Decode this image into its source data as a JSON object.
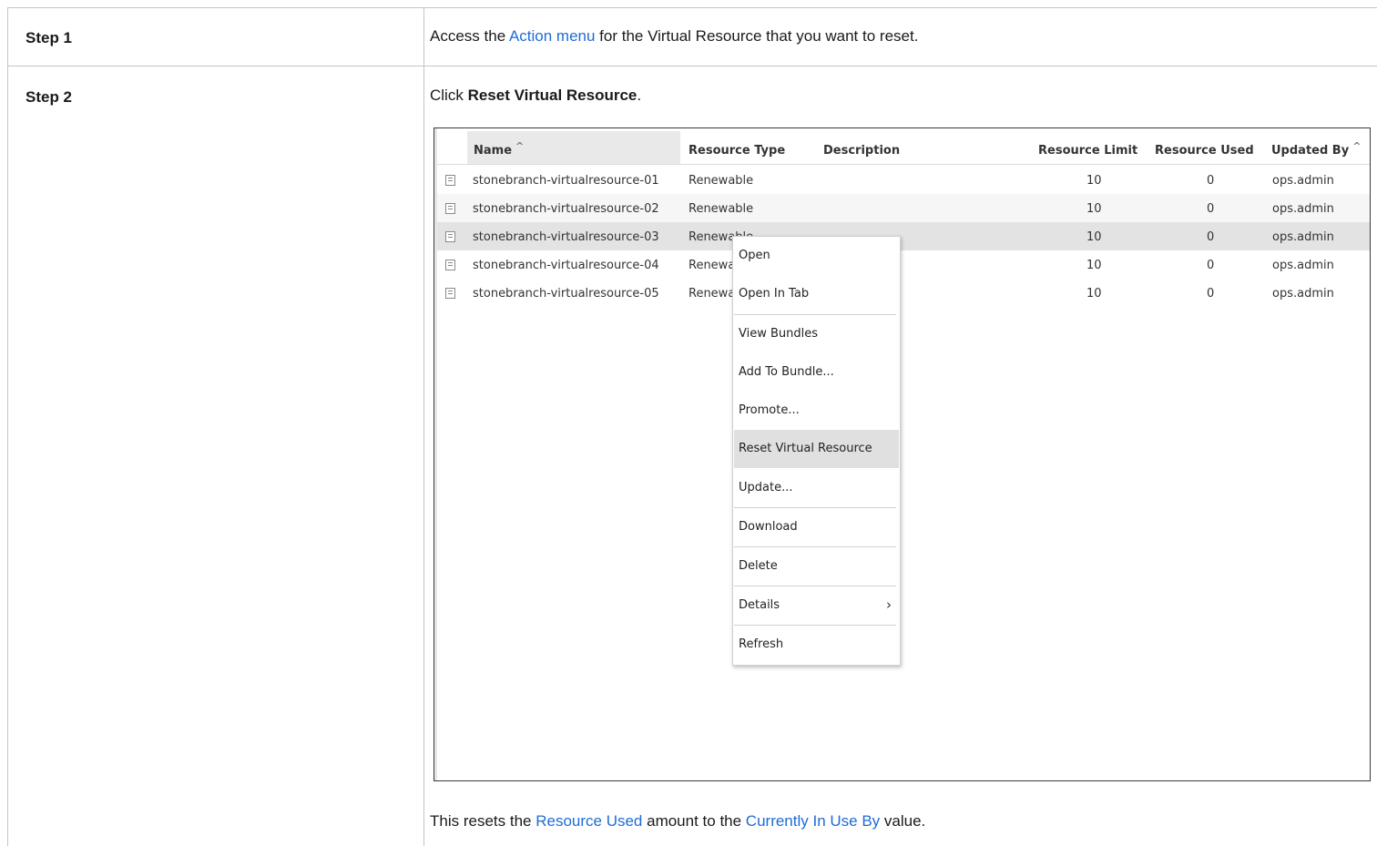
{
  "steps": [
    {
      "label": "Step 1",
      "text_before": "Access the ",
      "link": "Action menu",
      "text_after": " for the Virtual Resource that you want to reset."
    },
    {
      "label": "Step 2",
      "text_before": "Click ",
      "bold": "Reset Virtual Resource",
      "text_after": ".",
      "note_before": "This resets the ",
      "note_link1": "Resource Used",
      "note_middle": " amount to the ",
      "note_link2": "Currently In Use By",
      "note_after": " value."
    }
  ],
  "table": {
    "columns": {
      "name": "Name",
      "type": "Resource Type",
      "description": "Description",
      "limit": "Resource Limit",
      "used": "Resource Used",
      "updated": "Updated By"
    },
    "rows": [
      {
        "name": "stonebranch-virtualresource-01",
        "type": "Renewable",
        "limit": "10",
        "used": "0",
        "updated": "ops.admin"
      },
      {
        "name": "stonebranch-virtualresource-02",
        "type": "Renewable",
        "limit": "10",
        "used": "0",
        "updated": "ops.admin"
      },
      {
        "name": "stonebranch-virtualresource-03",
        "type": "Renewable",
        "limit": "10",
        "used": "0",
        "updated": "ops.admin"
      },
      {
        "name": "stonebranch-virtualresource-04",
        "type": "Renewable",
        "limit": "10",
        "used": "0",
        "updated": "ops.admin"
      },
      {
        "name": "stonebranch-virtualresource-05",
        "type": "Renewable",
        "limit": "10",
        "used": "0",
        "updated": "ops.admin"
      }
    ]
  },
  "context_menu": {
    "items": [
      "Open",
      "Open In Tab",
      "View Bundles",
      "Add To Bundle...",
      "Promote...",
      "Reset Virtual Resource",
      "Update...",
      "Download",
      "Delete",
      "Details",
      "Refresh"
    ],
    "highlighted": "Reset Virtual Resource",
    "submenu_item": "Details"
  },
  "colors": {
    "link": "#1f6bd6",
    "border": "#c4c4c4",
    "highlight": "#e0e0e0"
  }
}
